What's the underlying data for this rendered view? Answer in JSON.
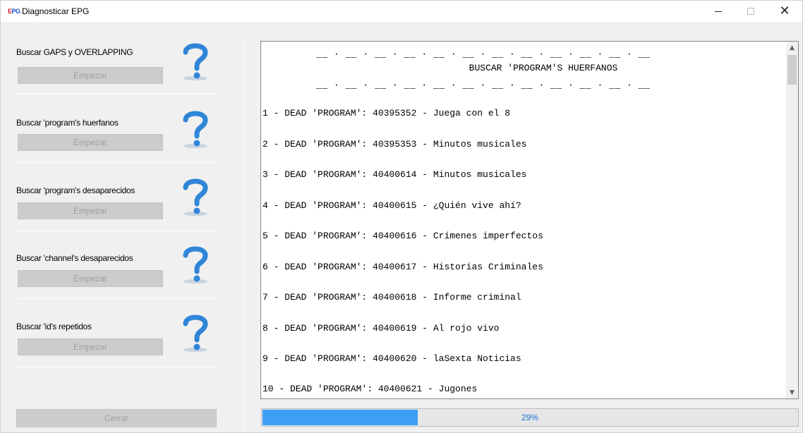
{
  "window": {
    "title": "Diagnosticar EPG",
    "icon_text_e": "E",
    "icon_text_pg": "PG"
  },
  "sections": [
    {
      "label": "Buscar GAPS y OVERLAPPING",
      "button": "Empezar"
    },
    {
      "label": "Buscar 'program's huerfanos",
      "button": "Empezar"
    },
    {
      "label": "Buscar 'program's desaparecidos",
      "button": "Empezar"
    },
    {
      "label": "Buscar 'channel's desaparecidos",
      "button": "Empezar"
    },
    {
      "label": "Buscar 'id's repetidos",
      "button": "Empezar"
    }
  ],
  "close_button": "Cerrar",
  "output": {
    "banner_dashes": "__ · __ · __ · __ · __ · __ · __ · __ · __ · __ · __ · __",
    "banner_title": "BUSCAR 'PROGRAM'S HUERFANOS",
    "lines": [
      "1 - DEAD 'PROGRAM': 40395352 - Juega con el 8",
      "2 - DEAD 'PROGRAM': 40395353 - Minutos musicales",
      "3 - DEAD 'PROGRAM': 40400614 - Minutos musicales",
      "4 - DEAD 'PROGRAM': 40400615 - ¿Quién vive ahí?",
      "5 - DEAD 'PROGRAM': 40400616 - Crímenes imperfectos",
      "6 - DEAD 'PROGRAM': 40400617 - Historias Criminales",
      "7 - DEAD 'PROGRAM': 40400618 - Informe criminal",
      "8 - DEAD 'PROGRAM': 40400619 - Al rojo vivo",
      "9 - DEAD 'PROGRAM': 40400620 - laSexta Noticias",
      "10 - DEAD 'PROGRAM': 40400621 - Jugones"
    ]
  },
  "progress": {
    "value": 0.29,
    "label": "29%"
  },
  "colors": {
    "progress_fill": "#3c9ef4",
    "help_icon": "#2f86d8"
  },
  "icons": {
    "help": "question-mark-icon",
    "minimize": "minimize-icon",
    "maximize": "maximize-icon",
    "close": "close-icon"
  }
}
